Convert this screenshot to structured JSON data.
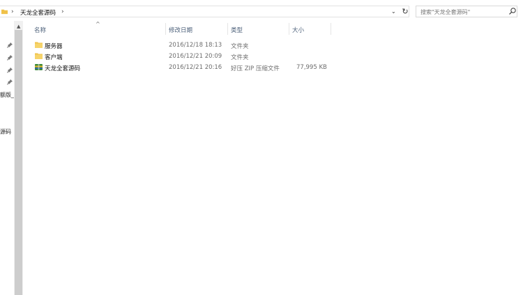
{
  "address": {
    "crumb": "天龙全套源码",
    "sep": "›"
  },
  "search": {
    "placeholder": "搜索\"天龙全套源码\""
  },
  "nav": {
    "labels": [
      "额版_",
      "源码"
    ]
  },
  "columns": {
    "name": "名称",
    "modified": "修改日期",
    "type": "类型",
    "size": "大小"
  },
  "files": [
    {
      "name": "服务器",
      "modified": "2016/12/18 18:13",
      "type": "文件夹",
      "size": "",
      "icon": "folder-icon"
    },
    {
      "name": "客户端",
      "modified": "2016/12/21 20:09",
      "type": "文件夹",
      "size": "",
      "icon": "folder-icon"
    },
    {
      "name": "天龙全套源码",
      "modified": "2016/12/21 20:16",
      "type": "好压 ZIP 压缩文件",
      "size": "77,995 KB",
      "icon": "zip-archive-icon"
    }
  ],
  "colors": {
    "header_text": "#4c607a",
    "folder": "#f0c24a",
    "detail_text": "#6d6d6d"
  }
}
